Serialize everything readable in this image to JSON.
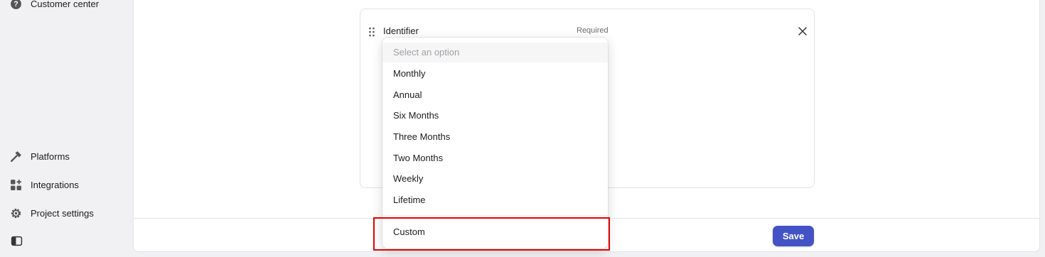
{
  "sidebar": {
    "items": [
      {
        "label": "Customer center",
        "icon": "question-circle-icon"
      },
      {
        "label": "Platforms",
        "icon": "hammer-icon"
      },
      {
        "label": "Integrations",
        "icon": "grid-plus-icon"
      },
      {
        "label": "Project settings",
        "icon": "gear-icon"
      }
    ],
    "collapse_icon": "sidebar-toggle-icon"
  },
  "card": {
    "field_label": "Identifier",
    "required_label": "Required"
  },
  "dropdown": {
    "placeholder": "Select an option",
    "options": [
      "Monthly",
      "Annual",
      "Six Months",
      "Three Months",
      "Two Months",
      "Weekly",
      "Lifetime",
      "Custom"
    ]
  },
  "footer": {
    "save_label": "Save"
  },
  "colors": {
    "accent": "#4353c6",
    "highlight": "#e00000"
  }
}
